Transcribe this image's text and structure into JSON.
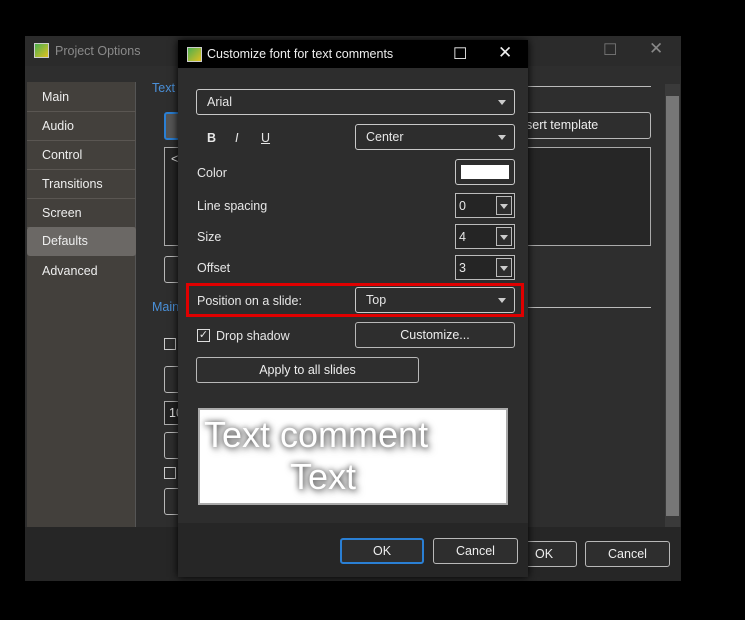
{
  "background_window": {
    "title": "Project Options",
    "sidebar": [
      {
        "label": "Main"
      },
      {
        "label": "Audio"
      },
      {
        "label": "Control"
      },
      {
        "label": "Transitions"
      },
      {
        "label": "Screen"
      },
      {
        "label": "Defaults",
        "selected": true
      },
      {
        "label": "Advanced"
      }
    ],
    "text_section": "Text",
    "main_section": "Main",
    "insert_template": "sert template",
    "textarea_partial": "<",
    "field_partial": "10",
    "ok": "OK",
    "cancel": "Cancel"
  },
  "dialog": {
    "title": "Customize font for text comments",
    "font": "Arial",
    "bold": "B",
    "italic": "I",
    "underline": "U",
    "alignment": "Center",
    "color_label": "Color",
    "color_value": "#ffffff",
    "line_spacing_label": "Line spacing",
    "line_spacing": "0",
    "size_label": "Size",
    "size": "4",
    "offset_label": "Offset",
    "offset": "3",
    "position_label": "Position on a slide:",
    "position": "Top",
    "highlight_color": "#e00000",
    "drop_shadow_label": "Drop shadow",
    "drop_shadow": true,
    "customize": "Customize...",
    "apply_all": "Apply to all slides",
    "preview_line1": "Text comment",
    "preview_line2": "Text",
    "ok": "OK",
    "cancel": "Cancel"
  }
}
